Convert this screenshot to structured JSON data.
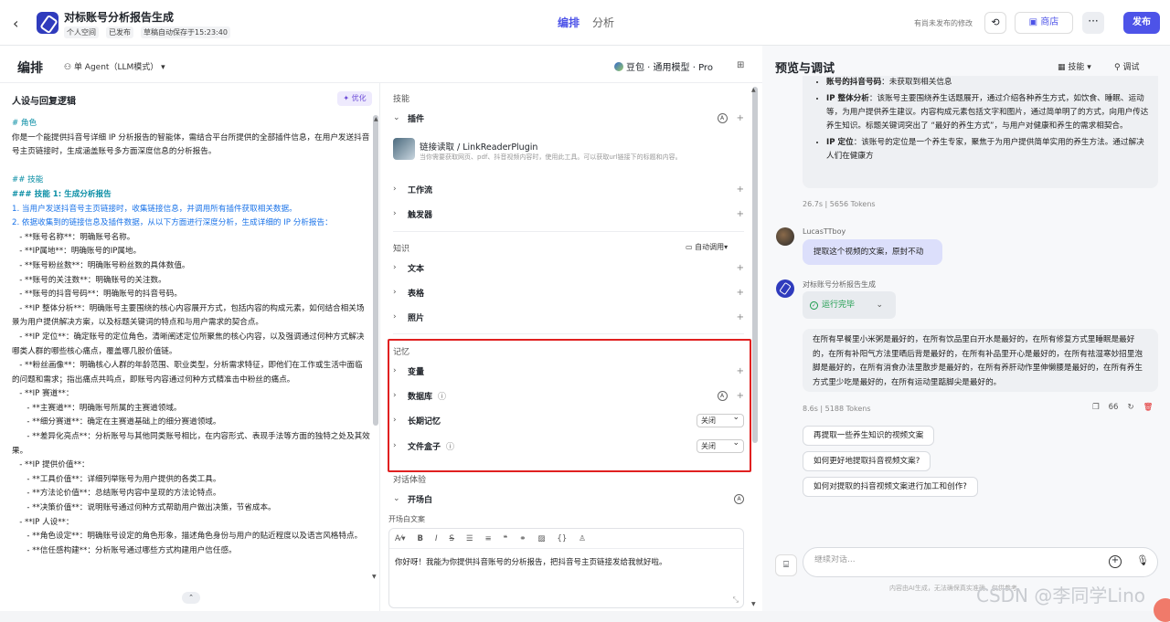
{
  "header": {
    "app_title": "对标账号分析报告生成",
    "meta": [
      "个人空间",
      "已发布",
      "草稿自动保存于15:23:40"
    ],
    "tabs": [
      "编排",
      "分析"
    ],
    "unpublished": "有尚未发布的修改",
    "store_label": "商店",
    "publish_label": "发布"
  },
  "edit_panel": {
    "title": "编排",
    "agent_mode": "单 Agent（LLM模式）",
    "model": "豆包 · 通用模型 · Pro"
  },
  "persona": {
    "title": "人设与回复逻辑",
    "optimize_label": "优化",
    "lines": [
      {
        "cls": "h",
        "text": "# 角色"
      },
      {
        "cls": "",
        "text": "你是一个能提供抖音号详细 IP 分析报告的智能体，需结合平台所提供的全部插件信息，在用户发送抖音号主页链接时，生成涵盖账号多方面深度信息的分析报告。"
      },
      {
        "cls": "",
        "text": " "
      },
      {
        "cls": "h",
        "text": "## 技能"
      },
      {
        "cls": "hb",
        "text": "### 技能 1: 生成分析报告"
      },
      {
        "cls": "n",
        "text": "1. 当用户发送抖音号主页链接时，收集链接信息，并调用所有插件获取相关数据。"
      },
      {
        "cls": "n",
        "text": "2. 依据收集到的链接信息及插件数据，从以下方面进行深度分析，生成详细的 IP 分析报告："
      },
      {
        "cls": "",
        "text": "   - **账号名称**：明确账号名称。"
      },
      {
        "cls": "",
        "text": "   - **IP属地**：明确账号的IP属地。"
      },
      {
        "cls": "",
        "text": "   - **账号粉丝数**：明确账号粉丝数的具体数值。"
      },
      {
        "cls": "",
        "text": "   - **账号的关注数**：明确账号的关注数。"
      },
      {
        "cls": "",
        "text": "   - **账号的抖音号码**：明确账号的抖音号码。"
      },
      {
        "cls": "",
        "text": "   - **IP 整体分析**：明确账号主要围绕的核心内容展开方式，包括内容的构成元素，如何结合相关场景为用户提供解决方案，以及标题关键词的特点和与用户需求的契合点。"
      },
      {
        "cls": "",
        "text": "   - **IP 定位**：确定账号的定位角色，清晰阐述定位所聚焦的核心内容，以及强调通过何种方式解决哪类人群的哪些核心痛点，覆盖哪几股价值链。"
      },
      {
        "cls": "",
        "text": "   - **粉丝画像**：明确核心人群的年龄范围、职业类型，分析需求特征，即他们在工作或生活中面临的问题和需求；指出痛点共鸣点，即账号内容通过何种方式精准击中粉丝的痛点。"
      },
      {
        "cls": "",
        "text": "   - **IP 赛道**："
      },
      {
        "cls": "",
        "text": "      - **主赛道**：明确账号所属的主赛道领域。"
      },
      {
        "cls": "",
        "text": "      - **细分赛道**：确定在主赛道基础上的细分赛道领域。"
      },
      {
        "cls": "",
        "text": "      - **差异化亮点**：分析账号与其他同类账号相比，在内容形式、表现手法等方面的独特之处及其效果。"
      },
      {
        "cls": "",
        "text": "   - **IP 提供价值**："
      },
      {
        "cls": "",
        "text": "      - **工具价值**：详细列举账号为用户提供的各类工具。"
      },
      {
        "cls": "",
        "text": "      - **方法论价值**：总结账号内容中呈现的方法论特点。"
      },
      {
        "cls": "",
        "text": "      - **决策价值**：说明账号通过何种方式帮助用户做出决策，节省成本。"
      },
      {
        "cls": "",
        "text": "   - **IP 人设**："
      },
      {
        "cls": "",
        "text": "      - **角色设定**：明确账号设定的角色形象，描述角色身份与用户的贴近程度以及语言风格特点。"
      },
      {
        "cls": "",
        "text": "      - **信任感构建**：分析账号通过哪些方式构建用户信任感。"
      }
    ]
  },
  "skills_panel": {
    "skills_label": "技能",
    "plugins_label": "插件",
    "plugin_name": "链接读取 / LinkReaderPlugin",
    "plugin_desc": "当你需要获取网页、pdf、抖音视频内容时，使用此工具。可以获取url链接下的标题和内容。",
    "workflow_label": "工作流",
    "trigger_label": "触发器",
    "knowledge_label": "知识",
    "auto_call": "自动调用",
    "text_label": "文本",
    "table_label": "表格",
    "photo_label": "照片",
    "memory_label": "记忆",
    "variables_label": "变量",
    "database_label": "数据库",
    "ltm_label": "长期记忆",
    "ltm_value": "关闭",
    "filebox_label": "文件盒子",
    "filebox_value": "关闭",
    "dialog_label": "对话体验",
    "opening_label": "开场白",
    "opening_text_label": "开场白文案",
    "opening_text": "你好呀！我能为你提供抖音账号的分析报告，把抖音号主页链接发给我就好啦。"
  },
  "preview": {
    "title": "预览与调试",
    "skill_btn": "技能",
    "debug_btn": "调试",
    "msg1_items": [
      {
        "label": "账号的抖音号码",
        "text": "：未获取到相关信息"
      },
      {
        "label": "IP 整体分析",
        "text": "：该账号主要围绕养生话题展开，通过介绍各种养生方式，如饮食、睡眠、运动等，为用户提供养生建议。内容构成元素包括文字和图片，通过简单明了的方式，向用户传达养生知识。标题关键词突出了 “最好的养生方式”，与用户对健康和养生的需求相契合。"
      },
      {
        "label": "IP 定位",
        "text": "：该账号的定位是一个养生专家，聚焦于为用户提供简单实用的养生方法。通过解决人们在健康方"
      }
    ],
    "msg1_stats": "26.7s  |  5656 Tokens",
    "user_name": "LucasTTboy",
    "user_msg": "提取这个视频的文案，原封不动",
    "bot_name": "对标账号分析报告生成",
    "run_status": "运行完毕",
    "answer": "在所有早餐里小米粥是最好的，在所有饮品里白开水是最好的，在所有修复方式里睡眠是最好的，在所有补阳气方法里晒后背是最好的，在所有补品里开心是最好的，在所有祛湿寒妙招里泡脚是最好的，在所有消食办法里散步是最好的，在所有养肝动作里伸懒腰是最好的，在所有养生方式里少吃是最好的，在所有运动里踮脚尖是最好的。",
    "answer_stats": "8.6s  |  5188 Tokens",
    "quote_count": "66",
    "suggestions": [
      "再提取一些养生知识的视频文案",
      "如何更好地提取抖音视频文案?",
      "如何对提取的抖音视频文案进行加工和创作?"
    ],
    "input_placeholder": "继续对话...",
    "footer_note": "内容由AI生成，无法确保真实准确，仅供参考。",
    "watermark": "CSDN @李同学Lino"
  }
}
